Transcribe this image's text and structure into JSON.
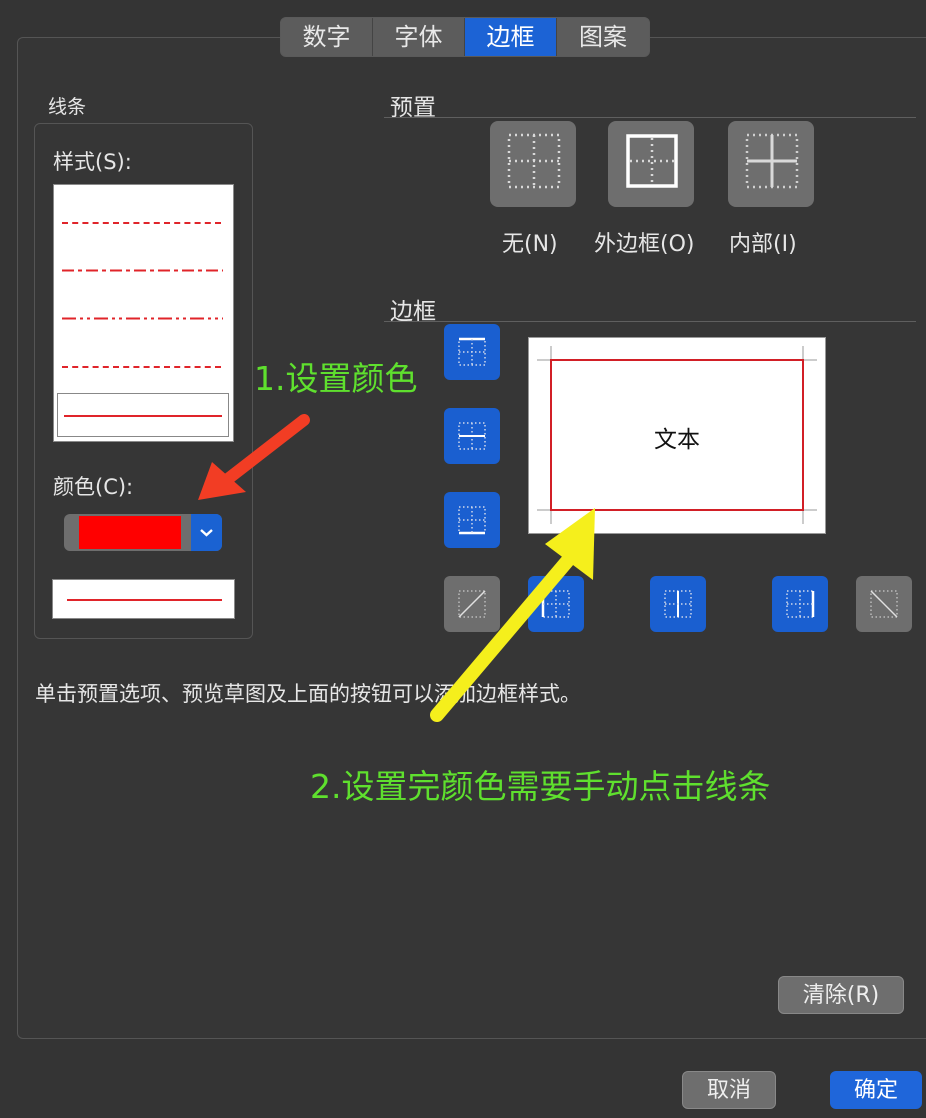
{
  "tabs": [
    "数字",
    "字体",
    "边框",
    "图案"
  ],
  "active_tab": "边框",
  "line_panel": {
    "title": "线条",
    "style_label": "样式(S):",
    "color_label": "颜色(C):",
    "selected_color": "#ff0000",
    "line_color": "#e0242a"
  },
  "preset": {
    "title": "预置",
    "items": [
      {
        "label": "无(N)",
        "icon": "border-none-icon"
      },
      {
        "label": "外边框(O)",
        "icon": "border-outline-icon"
      },
      {
        "label": "内部(I)",
        "icon": "border-inside-icon"
      }
    ]
  },
  "border": {
    "title": "边框",
    "preview_text": "文本"
  },
  "hint": "单击预置选项、预览草图及上面的按钮可以添加边框样式。",
  "annotations": {
    "step1": "1.设置颜色",
    "step2": "2.设置完颜色需要手动点击线条"
  },
  "buttons": {
    "clear": "清除(R)",
    "cancel": "取消",
    "ok": "确定"
  }
}
